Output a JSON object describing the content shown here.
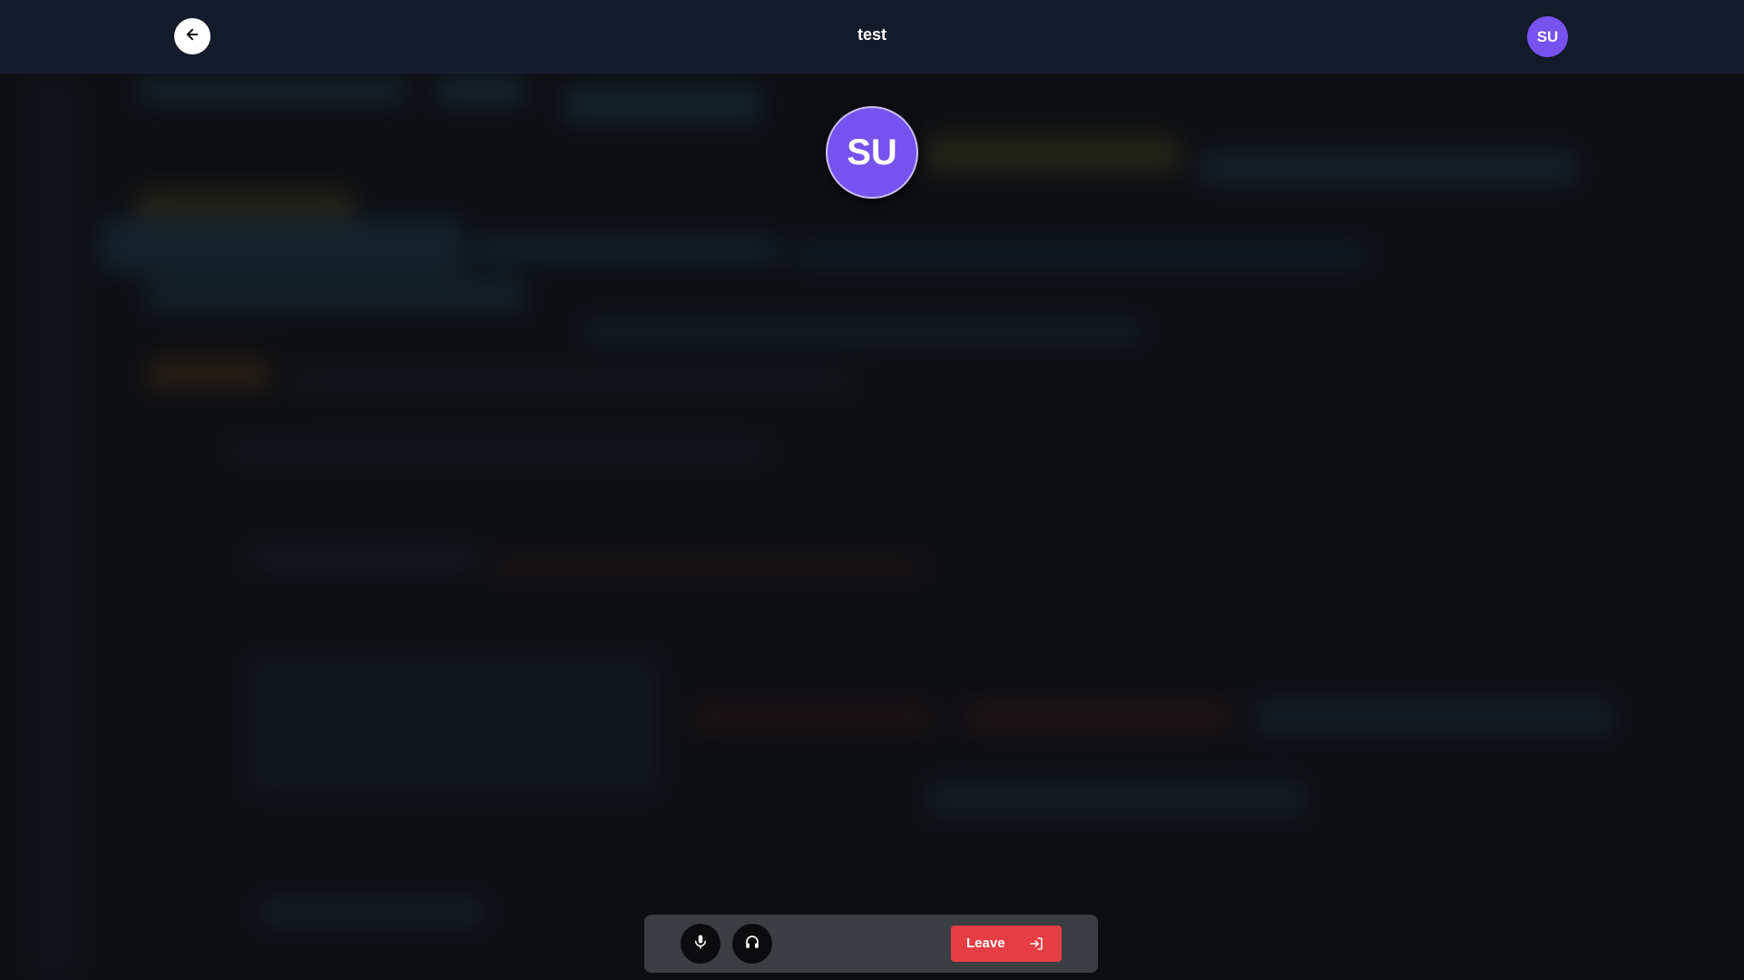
{
  "header": {
    "title": "test",
    "user_initials": "SU"
  },
  "participant": {
    "initials": "SU"
  },
  "controls": {
    "leave_label": "Leave"
  },
  "colors": {
    "topbar_bg": "#131a2a",
    "avatar_bg": "#7652ef",
    "leave_bg": "#e63e44",
    "control_bar_bg": "#3a3d42"
  },
  "icons": {
    "back": "arrow-left-icon",
    "mic": "microphone-icon",
    "headphones": "headphones-icon",
    "leave": "exit-icon"
  }
}
